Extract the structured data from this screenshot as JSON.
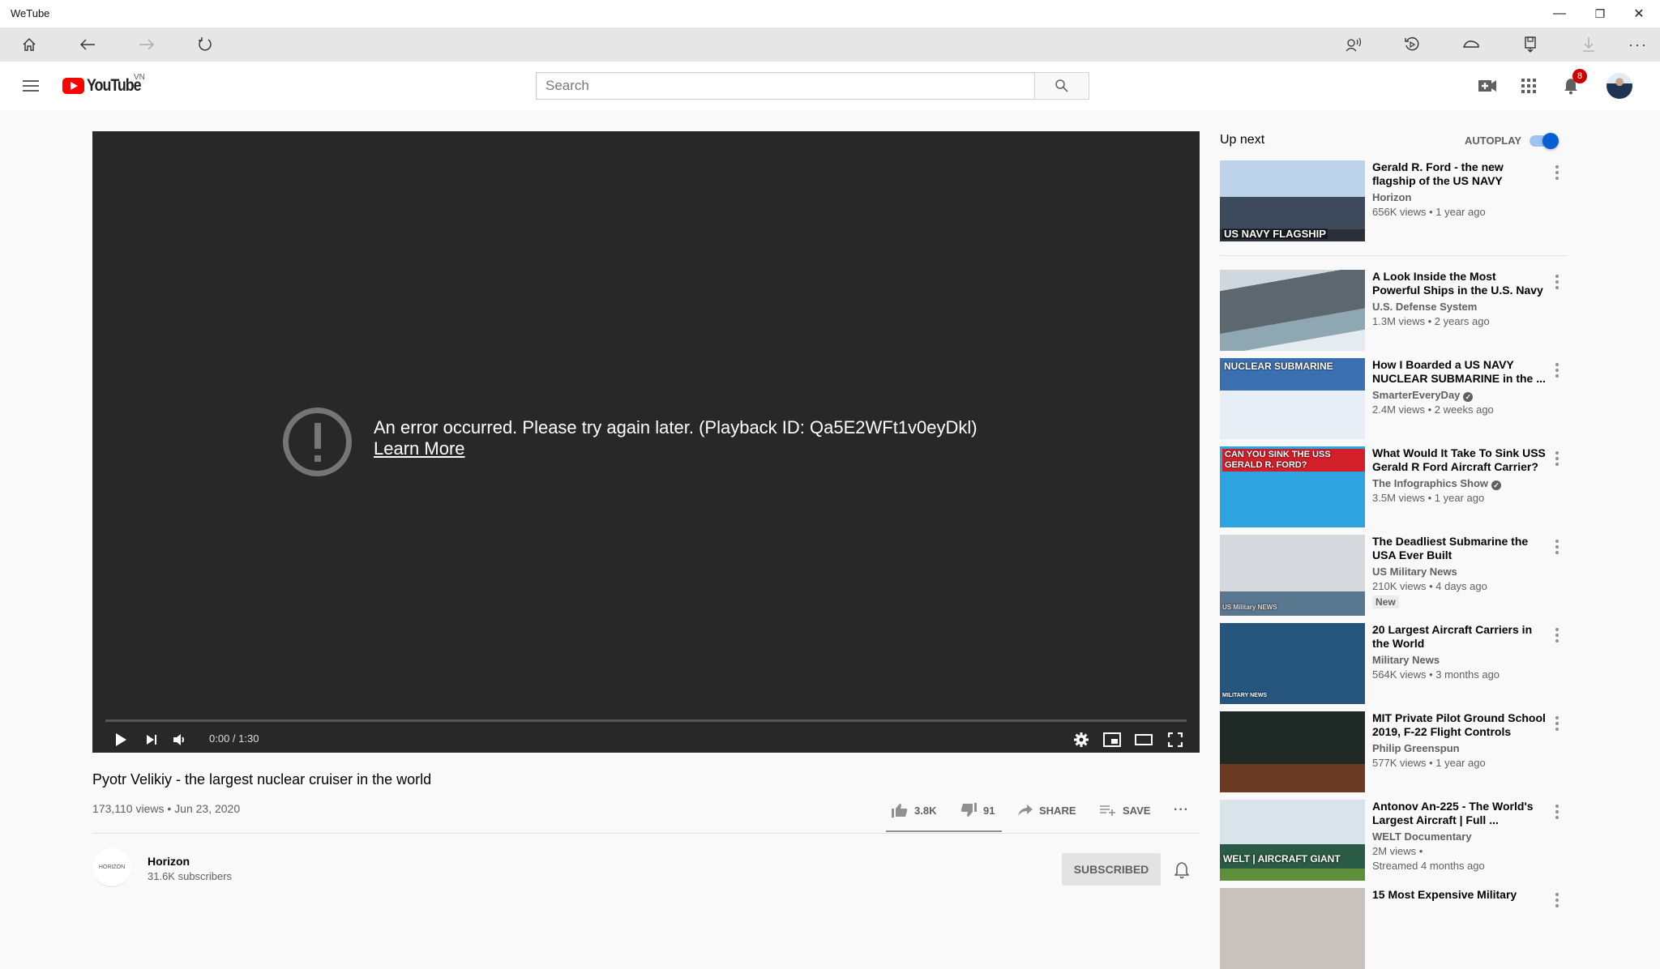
{
  "window": {
    "title": "WeTube",
    "controls": {
      "minimize": "—",
      "maximize": "❐",
      "close": "✕"
    }
  },
  "toolbar": {
    "left_icons": [
      "home-icon",
      "back-icon",
      "forward-icon",
      "refresh-icon"
    ],
    "right_icons": [
      "read-aloud-icon",
      "history-icon",
      "speed-icon",
      "save-icon",
      "download-icon",
      "more-icon"
    ],
    "more_label": "···"
  },
  "header": {
    "logo_text": "YouTube",
    "country_code": "VN",
    "search_placeholder": "Search",
    "search_value": "",
    "notification_count": "8"
  },
  "player": {
    "error_message": "An error occurred. Please try again later. (Playback ID: Qa5E2WFt1v0eyDkl)",
    "learn_more": "Learn More",
    "time": "0:00 / 1:30",
    "progress": 0
  },
  "video": {
    "title": "Pyotr Velikiy - the largest nuclear cruiser in the world",
    "views": "173,110 views",
    "date": "Jun 23, 2020",
    "meta_sep": " • ",
    "likes": "3.8K",
    "dislikes": "91",
    "like_ratio": 0.977,
    "share_label": "SHARE",
    "save_label": "SAVE",
    "more_label": "···",
    "channel": {
      "avatar_text": "HORIZON",
      "name": "Horizon",
      "subscribers": "31.6K subscribers",
      "subscribe_label": "SUBSCRIBED"
    }
  },
  "sidebar": {
    "up_next_label": "Up next",
    "autoplay_label": "AUTOPLAY",
    "autoplay_on": true,
    "items": [
      {
        "title": "Gerald R. Ford - the new flagship of the US NAVY",
        "channel": "Horizon",
        "verified": false,
        "meta": "656K views • 1 year ago",
        "thumb_caption": "US NAVY FLAGSHIP",
        "badge": ""
      },
      {
        "title": "A Look Inside the Most Powerful Ships in the U.S. Navy",
        "channel": "U.S. Defense System",
        "verified": false,
        "meta": "1.3M views • 2 years ago",
        "thumb_caption": "",
        "badge": ""
      },
      {
        "title": "How I Boarded a US NAVY NUCLEAR SUBMARINE in the ...",
        "channel": "SmarterEveryDay",
        "verified": true,
        "meta": "2.4M views • 2 weeks ago",
        "thumb_caption": "NUCLEAR SUBMARINE",
        "badge": ""
      },
      {
        "title": "What Would It Take To Sink USS Gerald R Ford Aircraft Carrier?",
        "channel": "The Infographics Show",
        "verified": true,
        "meta": "3.5M views • 1 year ago",
        "thumb_caption": "CAN YOU SINK THE USS GERALD R. FORD?",
        "badge": ""
      },
      {
        "title": "The Deadliest Submarine the USA Ever Built",
        "channel": "US Military News",
        "verified": false,
        "meta": "210K views • 4 days ago",
        "thumb_caption": "US Military NEWS",
        "badge": "New"
      },
      {
        "title": "20 Largest Aircraft Carriers in the World",
        "channel": "Military News",
        "verified": false,
        "meta": "564K views • 3 months ago",
        "thumb_caption": "MILITARY NEWS",
        "badge": ""
      },
      {
        "title": "MIT Private Pilot Ground School 2019, F-22 Flight Controls",
        "channel": "Philip Greenspun",
        "verified": false,
        "meta": "577K views • 1 year ago",
        "thumb_caption": "",
        "badge": ""
      },
      {
        "title": "Antonov An-225 - The World's Largest Aircraft | Full ...",
        "channel": "WELT Documentary",
        "verified": false,
        "meta": "2M views •",
        "meta2": "Streamed 4 months ago",
        "thumb_caption": "WELT | AIRCRAFT GIANT",
        "badge": ""
      },
      {
        "title": "15 Most Expensive Military",
        "channel": "",
        "verified": false,
        "meta": "",
        "thumb_caption": "",
        "badge": ""
      }
    ]
  }
}
